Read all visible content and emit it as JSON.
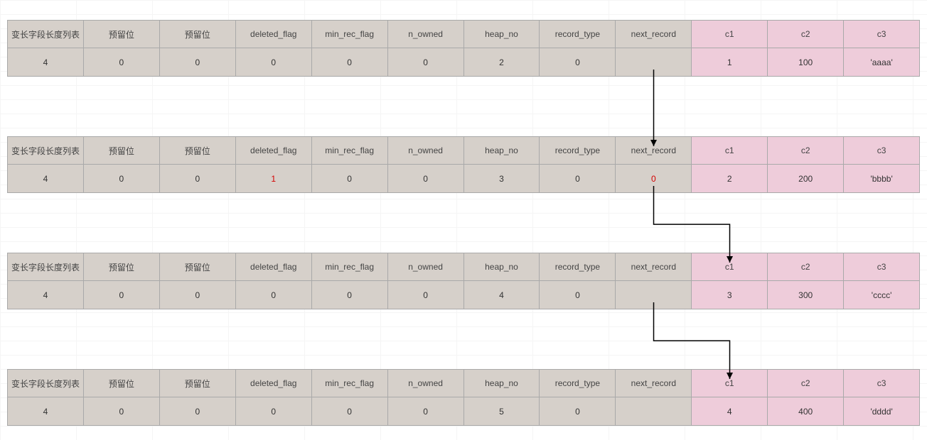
{
  "headers": {
    "gray": [
      "变长字段长度列表",
      "预留位",
      "预留位",
      "deleted_flag",
      "min_rec_flag",
      "n_owned",
      "heap_no",
      "record_type",
      "next_record"
    ],
    "pink": [
      "c1",
      "c2",
      "c3"
    ]
  },
  "records": [
    {
      "values": [
        "4",
        "0",
        "0",
        "0",
        "0",
        "0",
        "2",
        "0",
        ""
      ],
      "pink": [
        "1",
        "100",
        "'aaaa'"
      ],
      "red_cols": []
    },
    {
      "values": [
        "4",
        "0",
        "0",
        "1",
        "0",
        "0",
        "3",
        "0",
        "0"
      ],
      "pink": [
        "2",
        "200",
        "'bbbb'"
      ],
      "red_cols": [
        3,
        8
      ]
    },
    {
      "values": [
        "4",
        "0",
        "0",
        "0",
        "0",
        "0",
        "4",
        "0",
        ""
      ],
      "pink": [
        "3",
        "300",
        "'cccc'"
      ],
      "red_cols": []
    },
    {
      "values": [
        "4",
        "0",
        "0",
        "0",
        "0",
        "0",
        "5",
        "0",
        ""
      ],
      "pink": [
        "4",
        "400",
        "'dddd'"
      ],
      "red_cols": []
    }
  ],
  "arrows": [
    {
      "from_rec": 0,
      "mode": "straight"
    },
    {
      "from_rec": 1,
      "mode": "elbow"
    },
    {
      "from_rec": 2,
      "mode": "elbow"
    }
  ]
}
